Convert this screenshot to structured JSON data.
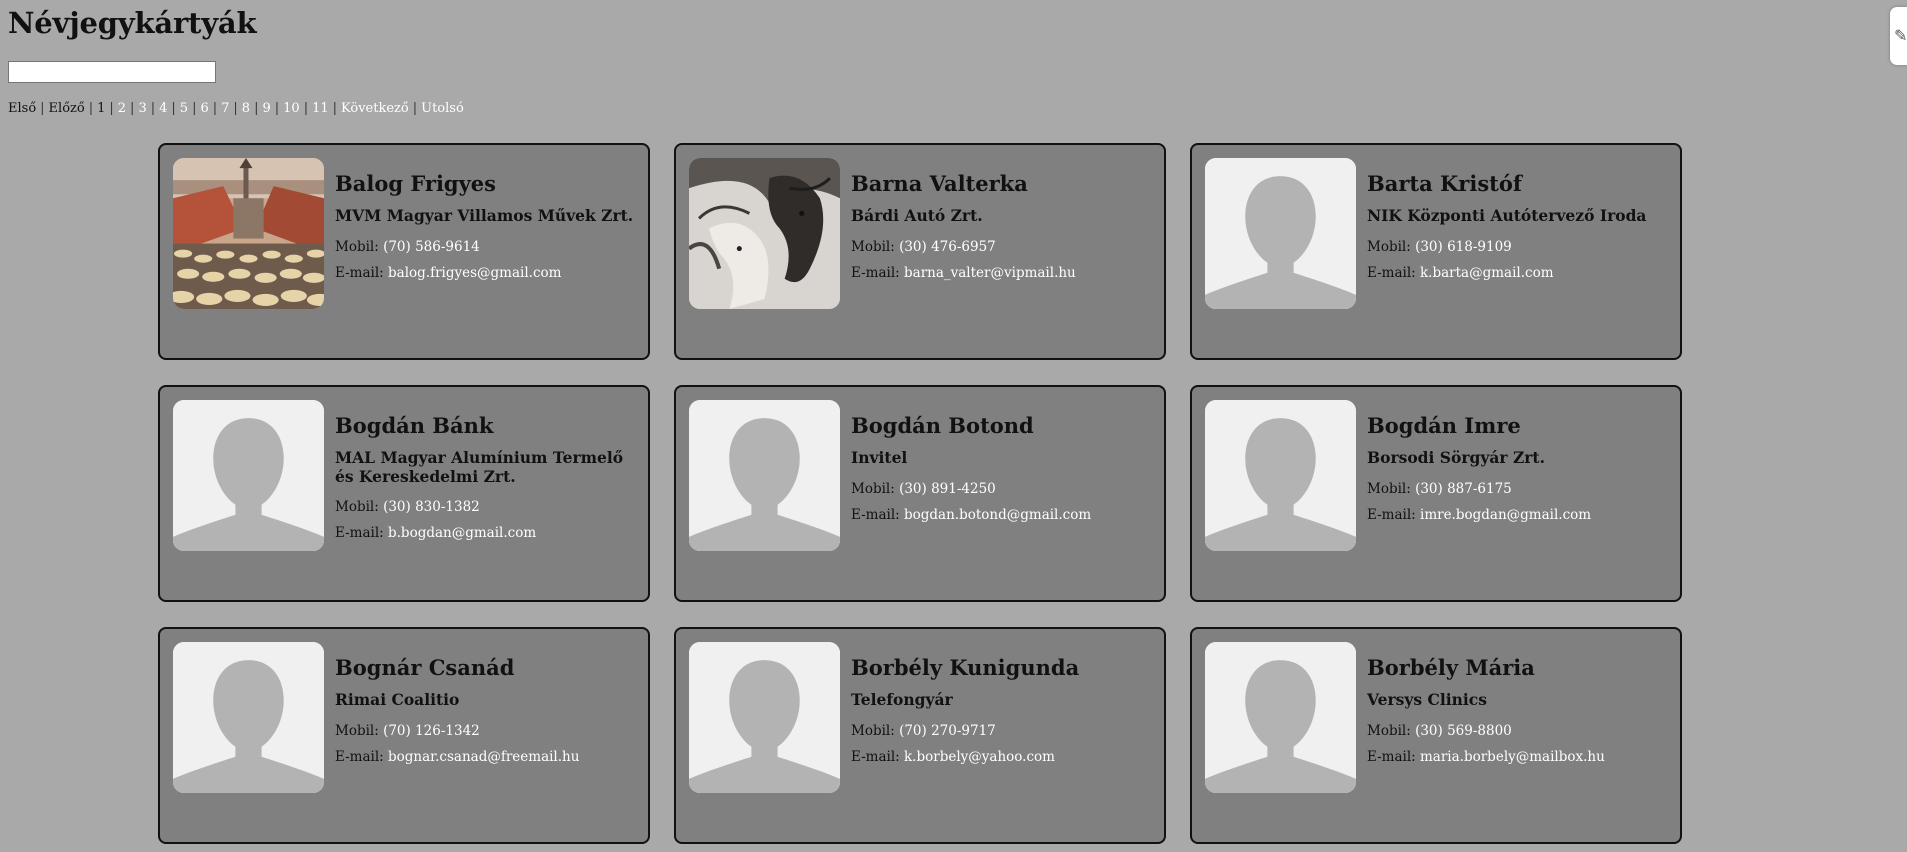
{
  "header": {
    "title": "Névjegykártyák"
  },
  "search": {
    "value": ""
  },
  "pager": {
    "first": "Első",
    "prev": "Előző",
    "pages": [
      "1",
      "2",
      "3",
      "4",
      "5",
      "6",
      "7",
      "8",
      "9",
      "10",
      "11"
    ],
    "next": "Következő",
    "last": "Utolsó",
    "separator": "|"
  },
  "cards": [
    {
      "name": "Balog Frigyes",
      "company": "MVM Magyar Villamos Művek Zrt.",
      "mobile_label": "Mobil:",
      "mobile": "(70) 586-9614",
      "email_label": "E-mail:",
      "email": "balog.frigyes@gmail.com",
      "photo": "town-crowd-photo"
    },
    {
      "name": "Barna Valterka",
      "company": "Bárdi Autó Zrt.",
      "mobile_label": "Mobil:",
      "mobile": "(30) 476-6957",
      "email_label": "E-mail:",
      "email": "barna_valter@vipmail.hu",
      "photo": "horses-photo"
    },
    {
      "name": "Barta Kristóf",
      "company": "NIK Központi Autótervező Iroda",
      "mobile_label": "Mobil:",
      "mobile": "(30) 618-9109",
      "email_label": "E-mail:",
      "email": "k.barta@gmail.com",
      "photo": "placeholder"
    },
    {
      "name": "Bogdán Bánk",
      "company": "MAL Magyar Alumínium Termelő és Kereskedelmi Zrt.",
      "mobile_label": "Mobil:",
      "mobile": "(30) 830-1382",
      "email_label": "E-mail:",
      "email": "b.bogdan@gmail.com",
      "photo": "placeholder"
    },
    {
      "name": "Bogdán Botond",
      "company": "Invitel",
      "mobile_label": "Mobil:",
      "mobile": "(30) 891-4250",
      "email_label": "E-mail:",
      "email": "bogdan.botond@gmail.com",
      "photo": "placeholder"
    },
    {
      "name": "Bogdán Imre",
      "company": "Borsodi Sörgyár Zrt.",
      "mobile_label": "Mobil:",
      "mobile": "(30) 887-6175",
      "email_label": "E-mail:",
      "email": "imre.bogdan@gmail.com",
      "photo": "placeholder"
    },
    {
      "name": "Bognár Csanád",
      "company": "Rimai Coalitio",
      "mobile_label": "Mobil:",
      "mobile": "(70) 126-1342",
      "email_label": "E-mail:",
      "email": "bognar.csanad@freemail.hu",
      "photo": "placeholder"
    },
    {
      "name": "Borbély Kunigunda",
      "company": "Telefongyár",
      "mobile_label": "Mobil:",
      "mobile": "(70) 270-9717",
      "email_label": "E-mail:",
      "email": "k.borbely@yahoo.com",
      "photo": "placeholder"
    },
    {
      "name": "Borbély Mária",
      "company": "Versys Clinics",
      "mobile_label": "Mobil:",
      "mobile": "(30) 569-8800",
      "email_label": "E-mail:",
      "email": "maria.borbely@mailbox.hu",
      "photo": "placeholder"
    }
  ],
  "colors": {
    "page_bg": "#a9a9a9",
    "card_bg": "#808080",
    "link_light": "#ffffff"
  }
}
